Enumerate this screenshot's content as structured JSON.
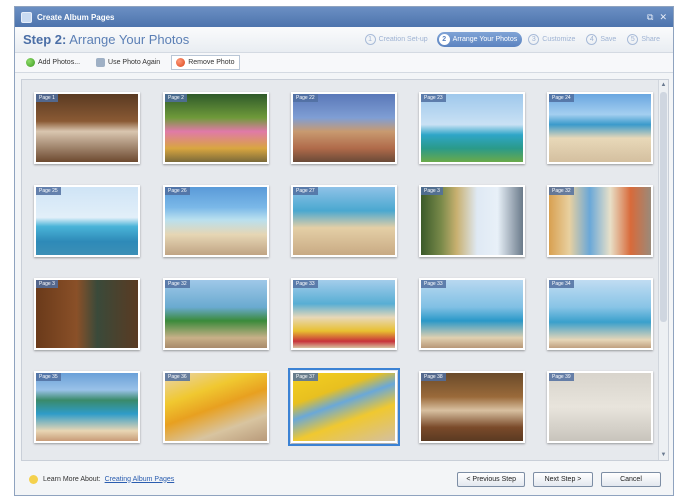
{
  "window": {
    "title": "Create Album Pages",
    "restore_glyph": "⧉",
    "close_glyph": "✕"
  },
  "header": {
    "step_label": "Step 2:",
    "step_title": "Arrange Your Photos",
    "steps": [
      {
        "num": "1",
        "label": "Creation Set-up",
        "active": false
      },
      {
        "num": "2",
        "label": "Arrange Your Photos",
        "active": true
      },
      {
        "num": "3",
        "label": "Customize",
        "active": false
      },
      {
        "num": "4",
        "label": "Save",
        "active": false
      },
      {
        "num": "5",
        "label": "Share",
        "active": false
      }
    ]
  },
  "toolbar": {
    "add_label": "Add Photos...",
    "reuse_label": "Use Photo Again",
    "remove_label": "Remove Photo"
  },
  "thumbnails": [
    {
      "page": "Page 1",
      "scene": "people-indoor"
    },
    {
      "page": "Page 2",
      "scene": "dancers"
    },
    {
      "page": "Page 22",
      "scene": "city-beach"
    },
    {
      "page": "Page 23",
      "scene": "ocean-calm"
    },
    {
      "page": "Page 24",
      "scene": "beach-crowd"
    },
    {
      "page": "Page 25",
      "scene": "sailboat"
    },
    {
      "page": "Page 26",
      "scene": "umbrella"
    },
    {
      "page": "Page 27",
      "scene": "beach-people"
    },
    {
      "page": "Page 3",
      "scene": "surfboards"
    },
    {
      "page": "Page 32",
      "scene": "surfboards2"
    },
    {
      "page": "Page 3",
      "scene": "sign"
    },
    {
      "page": "Page 32",
      "scene": "palms"
    },
    {
      "page": "Page 33",
      "scene": "canoe"
    },
    {
      "page": "Page 33",
      "scene": "catamaran"
    },
    {
      "page": "Page 34",
      "scene": "catamaran2"
    },
    {
      "page": "Page 35",
      "scene": "waikiki"
    },
    {
      "page": "Page 36",
      "scene": "kayaks"
    },
    {
      "page": "Page 37",
      "scene": "yellow-kayaks"
    },
    {
      "page": "Page 38",
      "scene": "bar"
    },
    {
      "page": "Page 39",
      "scene": "plaque"
    }
  ],
  "selected_index": 17,
  "footer": {
    "learn_label": "Learn More About:",
    "link_label": "Creating Album Pages",
    "prev_label": "< Previous Step",
    "next_label": "Next Step >",
    "cancel_label": "Cancel"
  },
  "scrollbar": {
    "up_glyph": "▲",
    "down_glyph": "▼"
  }
}
